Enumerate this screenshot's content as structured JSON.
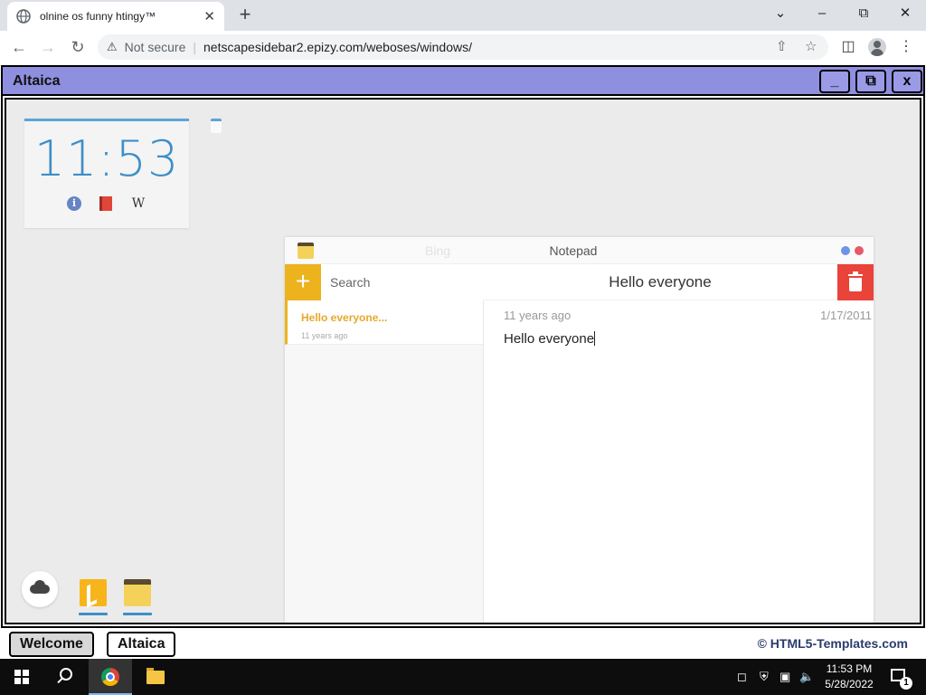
{
  "browser": {
    "tab_title": "olnine os funny htingy™",
    "security_label": "Not secure",
    "url": "netscapesidebar2.epizy.com/weboses/windows/",
    "new_tab_symbol": "+",
    "close_symbol": "✕"
  },
  "window": {
    "title": "Altaica",
    "minimize_label": "_",
    "maximize_label": "⧉",
    "close_label": "x"
  },
  "clock_widget": {
    "time": "11:53",
    "info_icon": "i",
    "wiki_icon": "W"
  },
  "notepad": {
    "ghost_title": "Bing",
    "title": "Notepad",
    "add_label": "+",
    "search_placeholder": "Search",
    "dot_colors": [
      "#6f93e8",
      "#e65a6a"
    ],
    "notes": [
      {
        "title": "Hello everyone...",
        "age": "11 years ago"
      }
    ],
    "current": {
      "title": "Hello everyone",
      "age": "11 years ago",
      "date": "1/17/2011",
      "body": "Hello everyone"
    }
  },
  "dock": {
    "apps": [
      "cloud",
      "bing",
      "notepad"
    ]
  },
  "bottom_bar": {
    "windows": [
      "Welcome",
      "Altaica"
    ],
    "active_window": "Welcome",
    "credit": "© HTML5-Templates.com"
  },
  "taskbar": {
    "time": "11:53 PM",
    "date": "5/28/2022",
    "notification_count": "1"
  }
}
